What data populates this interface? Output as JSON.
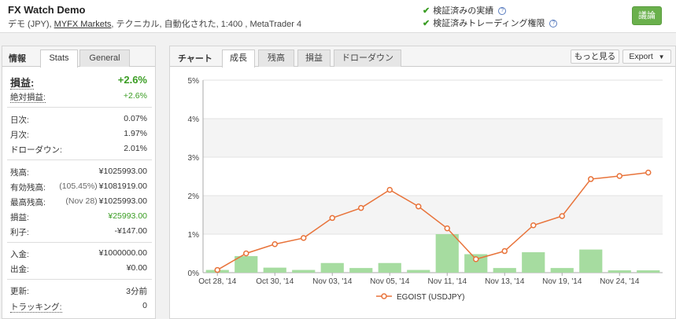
{
  "account": {
    "title": "FX Watch   Demo",
    "sub_prefix": "デモ (JPY), ",
    "broker": "MYFX Markets",
    "sub_suffix": ", テクニカル, 自動化された, 1:400 , MetaTrader 4"
  },
  "verification": {
    "track_record": "検証済みの実績",
    "trading_privileges": "検証済みトレーディング権限"
  },
  "discuss_button": "議論",
  "info": {
    "tab_head": "情報",
    "tabs": [
      "Stats",
      "General"
    ],
    "rows": {
      "gain": {
        "label": "損益:",
        "value": "+2.6%"
      },
      "abs_gain": {
        "label": "絶対損益:",
        "value": "+2.6%"
      },
      "daily": {
        "label": "日次:",
        "value": "0.07%"
      },
      "monthly": {
        "label": "月次:",
        "value": "1.97%"
      },
      "drawdown": {
        "label": "ドローダウン:",
        "value": "2.01%"
      },
      "balance": {
        "label": "残高:",
        "value": "¥1025993.00"
      },
      "equity": {
        "label": "有効残高:",
        "note": "(105.45%)",
        "value": "¥1081919.00"
      },
      "highest": {
        "label": "最高残高:",
        "note": "(Nov 28)",
        "value": "¥1025993.00"
      },
      "profit": {
        "label": "損益:",
        "value": "¥25993.00"
      },
      "interest": {
        "label": "利子:",
        "value": "-¥147.00"
      },
      "deposits": {
        "label": "入金:",
        "value": "¥1000000.00"
      },
      "withdrawals": {
        "label": "出金:",
        "value": "¥0.00"
      },
      "updated": {
        "label": "更新:",
        "value": "3分前"
      },
      "tracking": {
        "label": "トラッキング:",
        "value": "0"
      }
    }
  },
  "chart_panel": {
    "tab_head": "チャート",
    "tabs": [
      "成長",
      "残高",
      "損益",
      "ドローダウン"
    ],
    "more_button": "もっと見る",
    "export_button": "Export"
  },
  "chart_data": {
    "type": "line",
    "xlabel": "",
    "ylabel": "",
    "ylim": [
      0,
      5
    ],
    "y_ticks": [
      "0%",
      "1%",
      "2%",
      "3%",
      "4%",
      "5%"
    ],
    "x_tick_labels": [
      "Oct 28, '14",
      "Oct 30, '14",
      "Nov 03, '14",
      "Nov 05, '14",
      "Nov 11, '14",
      "Nov 13, '14",
      "Nov 19, '14",
      "Nov 24, '14"
    ],
    "x_tick_index": [
      0,
      2,
      4,
      6,
      8,
      10,
      12,
      14
    ],
    "series": [
      {
        "name": "EGOIST (USDJPY)",
        "type": "line",
        "color": "#e8733a",
        "values": [
          0.07,
          0.5,
          0.74,
          0.9,
          1.42,
          1.68,
          2.15,
          1.72,
          1.15,
          0.35,
          0.56,
          1.23,
          1.47,
          2.43,
          2.51,
          2.6
        ]
      },
      {
        "type": "bar",
        "color": "#a6dca0",
        "values": [
          0.07,
          0.43,
          0.13,
          0.07,
          0.25,
          0.12,
          0.25,
          0.07,
          1.0,
          0.48,
          0.12,
          0.53,
          0.12,
          0.6,
          0.06,
          0.06
        ]
      }
    ],
    "grid": true,
    "legend_position": "bottom"
  }
}
